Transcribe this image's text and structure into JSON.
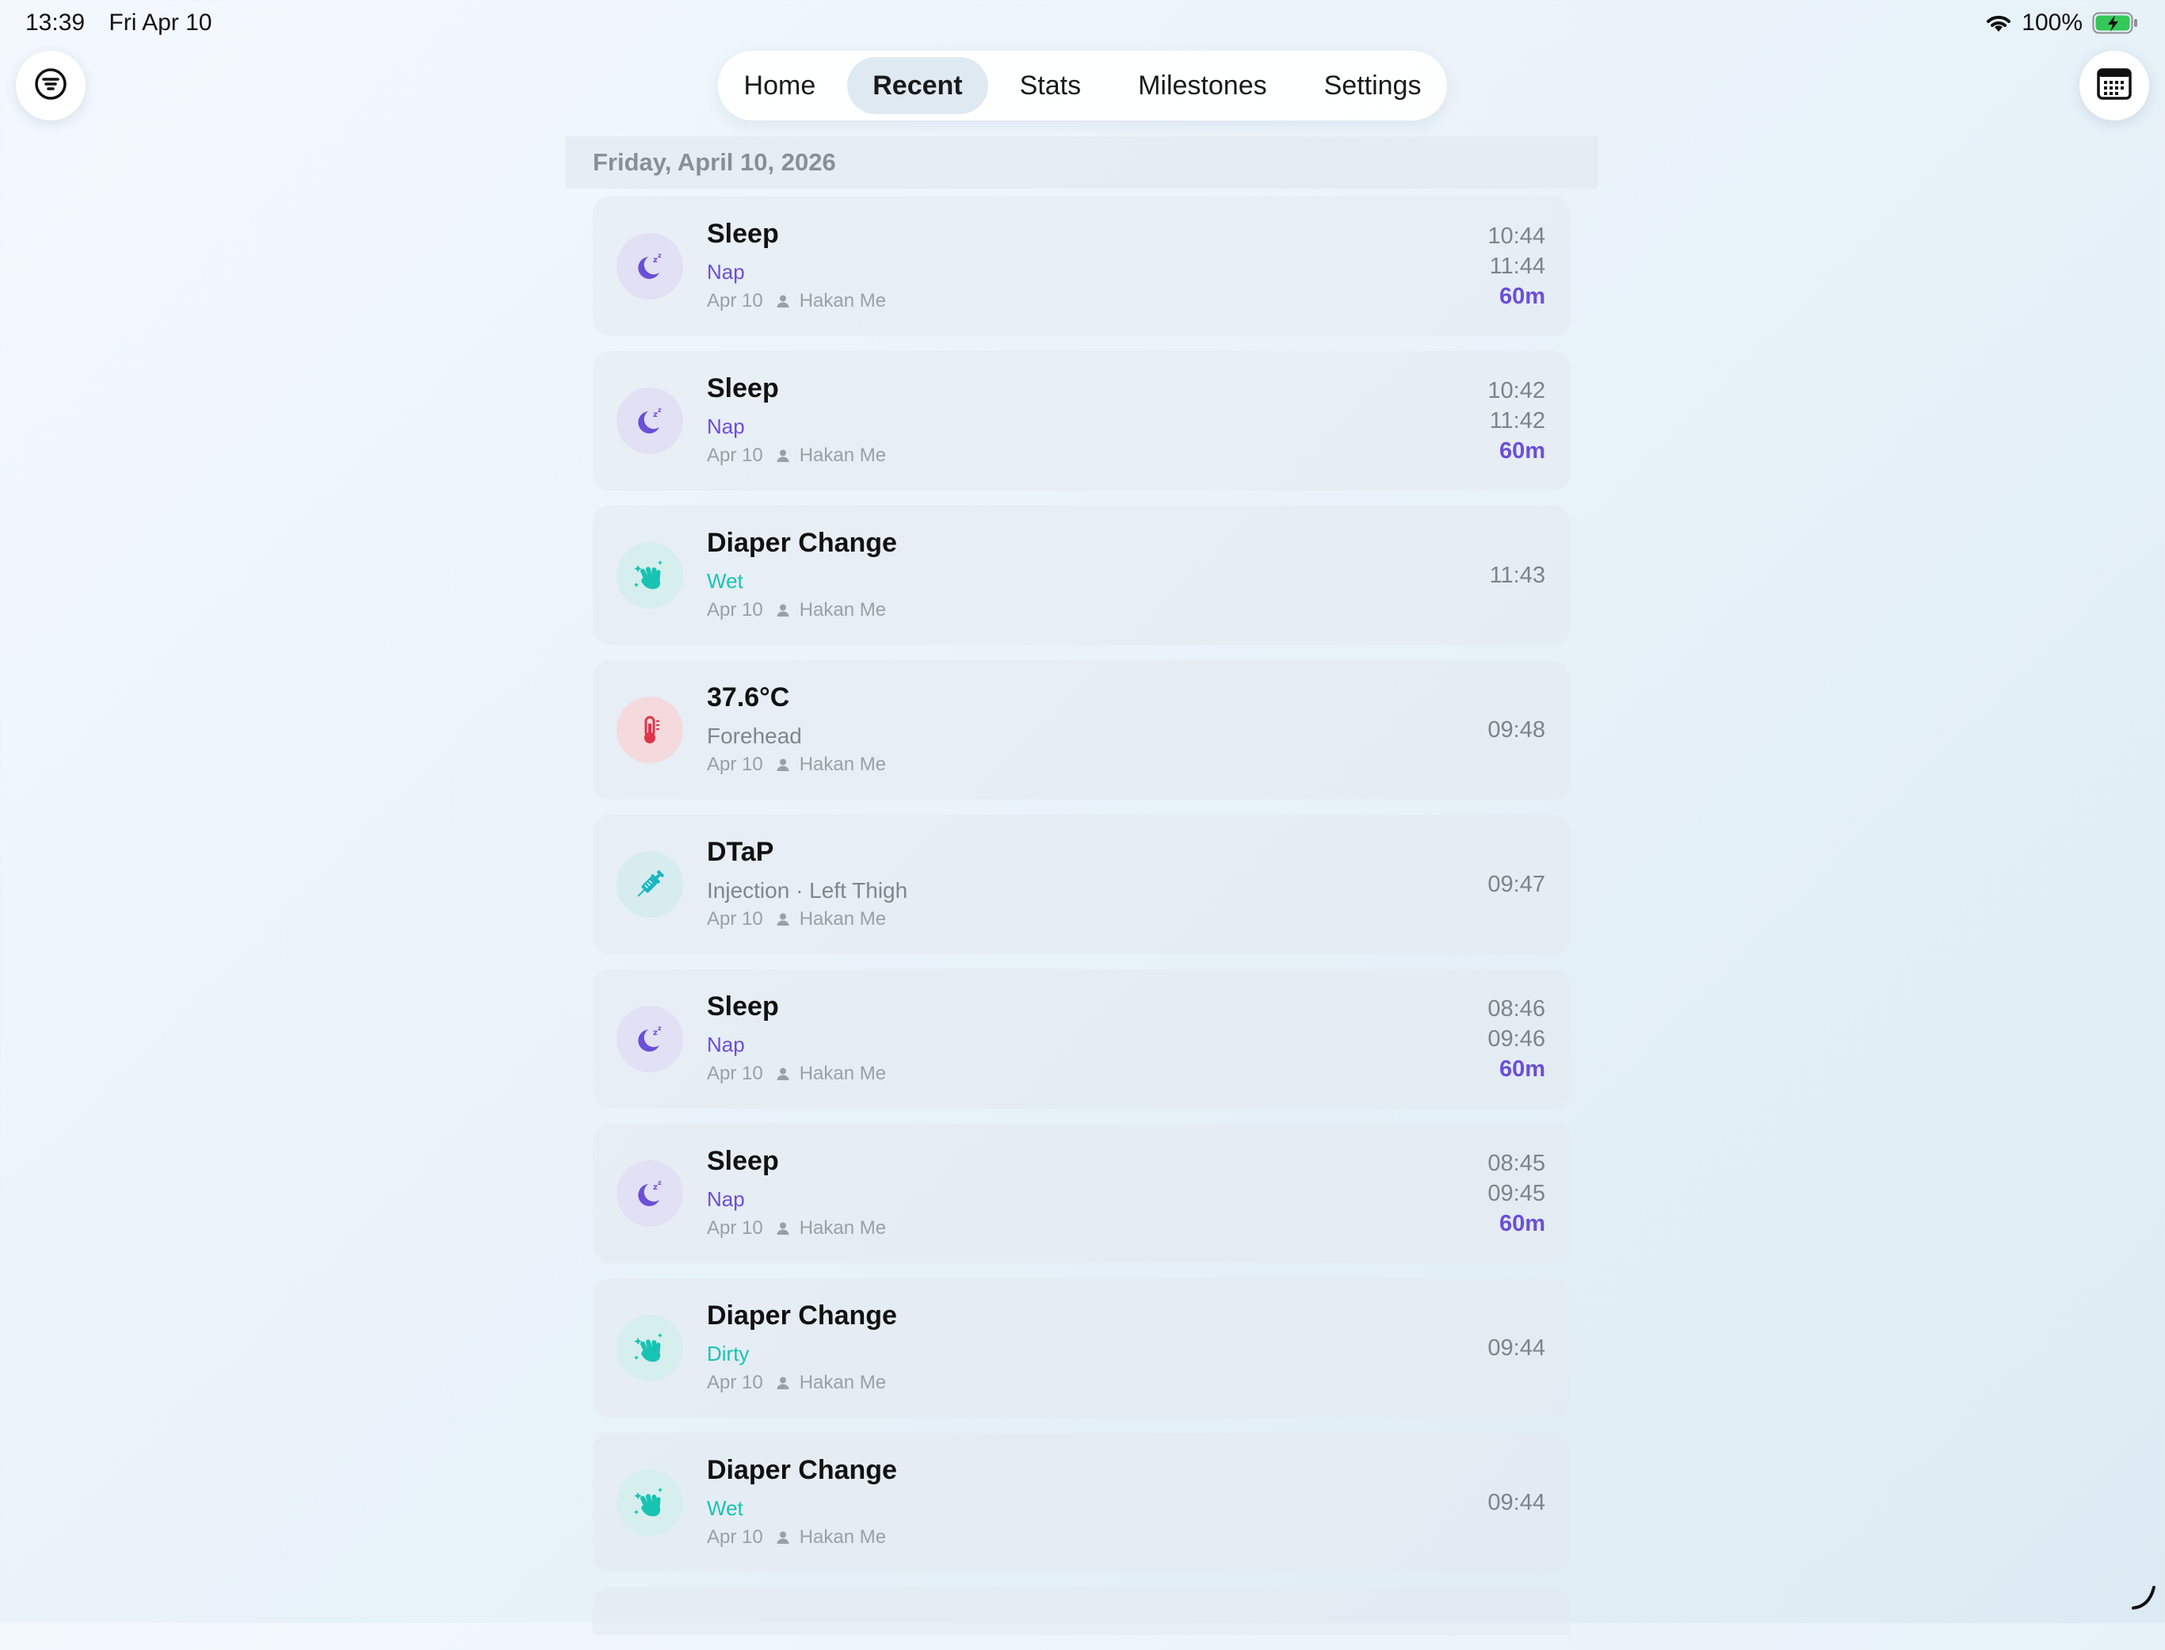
{
  "status_bar": {
    "time": "13:39",
    "date": "Fri Apr 10",
    "battery": "100%"
  },
  "nav": {
    "tabs": [
      {
        "label": "Home"
      },
      {
        "label": "Recent"
      },
      {
        "label": "Stats"
      },
      {
        "label": "Milestones"
      },
      {
        "label": "Settings"
      }
    ],
    "active": "Recent"
  },
  "list": {
    "date_header": "Friday, April 10, 2026",
    "entries": [
      {
        "title": "Sleep",
        "subtitle": "Nap",
        "date": "Apr 10",
        "user": "Hakan Me",
        "start": "10:44",
        "end": "11:44",
        "duration": "60m"
      },
      {
        "title": "Sleep",
        "subtitle": "Nap",
        "date": "Apr 10",
        "user": "Hakan Me",
        "start": "10:42",
        "end": "11:42",
        "duration": "60m"
      },
      {
        "title": "Diaper Change",
        "subtitle": "Wet",
        "date": "Apr 10",
        "user": "Hakan Me",
        "time": "11:43"
      },
      {
        "title": "37.6°C",
        "subtitle": "Forehead",
        "date": "Apr 10",
        "user": "Hakan Me",
        "time": "09:48"
      },
      {
        "title": "DTaP",
        "subtitle": "Injection · Left Thigh",
        "date": "Apr 10",
        "user": "Hakan Me",
        "time": "09:47"
      },
      {
        "title": "Sleep",
        "subtitle": "Nap",
        "date": "Apr 10",
        "user": "Hakan Me",
        "start": "08:46",
        "end": "09:46",
        "duration": "60m"
      },
      {
        "title": "Sleep",
        "subtitle": "Nap",
        "date": "Apr 10",
        "user": "Hakan Me",
        "start": "08:45",
        "end": "09:45",
        "duration": "60m"
      },
      {
        "title": "Diaper Change",
        "subtitle": "Dirty",
        "date": "Apr 10",
        "user": "Hakan Me",
        "time": "09:44"
      },
      {
        "title": "Diaper Change",
        "subtitle": "Wet",
        "date": "Apr 10",
        "user": "Hakan Me",
        "time": "09:44"
      }
    ]
  },
  "colors": {
    "accent_purple": "#6b4fd8",
    "accent_teal": "#19c3b3",
    "temp_red": "#e0344a",
    "battery_green": "#34c759"
  },
  "icons": {
    "filter": "filter-icon",
    "calendar": "calendar-icon",
    "sleep": "moon-zzz-icon",
    "diaper": "clean-hands-icon",
    "temperature": "thermometer-icon",
    "vaccine": "syringe-icon",
    "user": "person-icon"
  }
}
